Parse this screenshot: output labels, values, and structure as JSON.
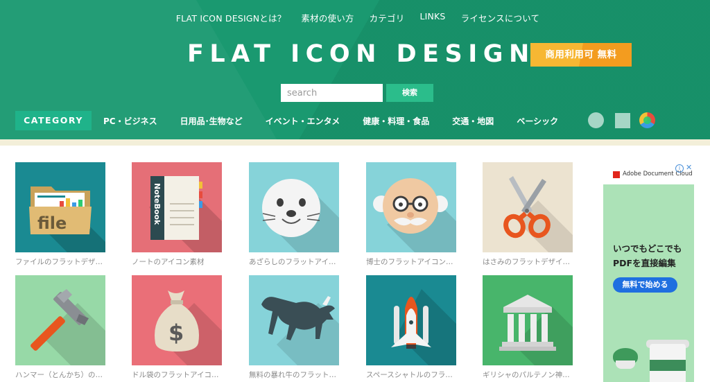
{
  "header": {
    "nav": [
      "FLAT ICON DESIGNとは？",
      "素材の使い方",
      "カテゴリ",
      "LINKS",
      "ライセンスについて"
    ],
    "logo": "FLAT ICON DESIGN",
    "badge": "商用利用可 無料",
    "search": {
      "placeholder": "search",
      "button": "検索"
    },
    "category_label": "CATEGORY",
    "categories": [
      "PC・ビジネス",
      "日用品･生物など",
      "イベント・エンタメ",
      "健康・料理・食品",
      "交通・地図",
      "ベーシック"
    ],
    "style_icons": [
      "circle-style-icon",
      "square-style-icon",
      "color-style-icon"
    ]
  },
  "icons": [
    {
      "caption": "ファイルのフラットデザ…",
      "bg": "#1a8a92",
      "icon": "file-folder-icon"
    },
    {
      "caption": "ノートのアイコン素材",
      "bg": "#e56f77",
      "icon": "notebook-icon"
    },
    {
      "caption": "あざらしのフラットアイ…",
      "bg": "#86d3d9",
      "icon": "seal-icon"
    },
    {
      "caption": "博士のフラットアイコン…",
      "bg": "#86d3d9",
      "icon": "professor-icon"
    },
    {
      "caption": "はさみのフラットデザイ…",
      "bg": "#ece3d0",
      "icon": "scissors-icon"
    },
    {
      "caption": "ハンマー（とんかち）の…",
      "bg": "#97d9a7",
      "icon": "hammer-icon"
    },
    {
      "caption": "ドル袋のフラットアイコ…",
      "bg": "#ea6f78",
      "icon": "money-bag-icon"
    },
    {
      "caption": "無料の暴れ牛のフラット…",
      "bg": "#86d3d9",
      "icon": "bull-icon"
    },
    {
      "caption": "スペースシャトルのフラ…",
      "bg": "#1a8a92",
      "icon": "space-shuttle-icon"
    },
    {
      "caption": "ギリシャのパルテノン神…",
      "bg": "#48b56b",
      "icon": "parthenon-icon"
    }
  ],
  "icon_texts": {
    "file": "file",
    "notebook": "NoteBook",
    "dollar": "$"
  },
  "ad": {
    "brand": "Adobe Document Cloud",
    "info": "i",
    "close": "✕",
    "headline": "いつでもどこでも\nPDFを直接編集",
    "cta": "無料で始める"
  },
  "colors": {
    "header_green": "#1a9970",
    "category_green": "#1fb38a",
    "badge_orange": "#f5a623",
    "ad_green": "#ace2b7",
    "ad_button_blue": "#1f6fe0"
  }
}
